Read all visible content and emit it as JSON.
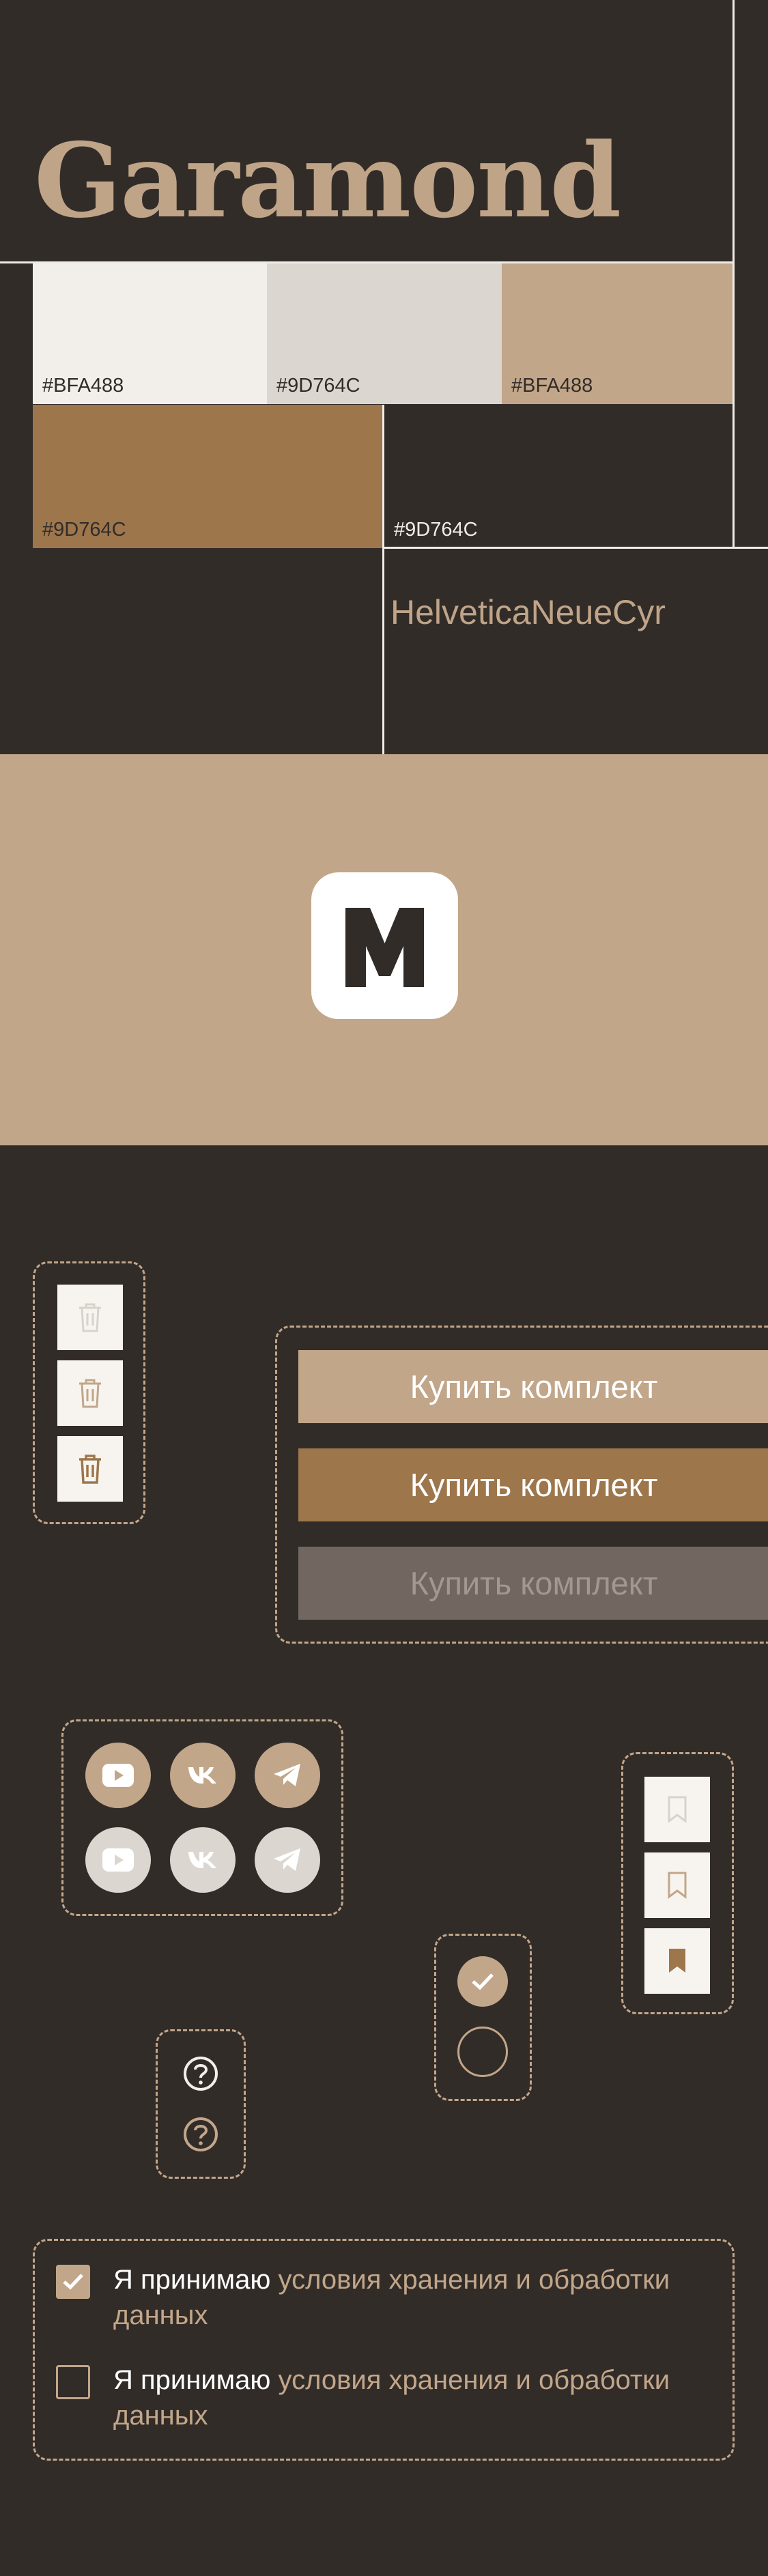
{
  "palette": {
    "title_serif": "Garamond",
    "title_sans": "HelveticaNeueCyr",
    "swatches": [
      {
        "hex": "#BFA488",
        "color": "#f2efea"
      },
      {
        "hex": "#9D764C",
        "color": "#dbd6d0"
      },
      {
        "hex": "#BFA488",
        "color": "#c2a689"
      },
      {
        "hex": "#9D764C",
        "color": "#9d764c"
      },
      {
        "hex": "#9D764C",
        "color": "#322c29"
      }
    ]
  },
  "brand": {
    "logo_letter": "M",
    "colors": {
      "dark": "#322c29",
      "beige": "#c2a689",
      "brown": "#9d764c",
      "light": "#f2efea",
      "gray": "#dbd6d0"
    }
  },
  "buttons": {
    "buy_default": "Купить комплект",
    "buy_hover": "Купить комплект",
    "buy_disabled": "Купить комплект"
  },
  "icons": {
    "trash": [
      "trash-icon-disabled",
      "trash-icon-default",
      "trash-icon-hover"
    ],
    "social": [
      "youtube-icon",
      "vk-icon",
      "telegram-icon"
    ],
    "bookmark": [
      "bookmark-icon-disabled",
      "bookmark-icon-default",
      "bookmark-icon-active"
    ],
    "help": "question-icon"
  },
  "consent": {
    "checked": {
      "prefix": "Я принимаю ",
      "link": "условия хранения и обработки данных",
      "state": "checked"
    },
    "unchecked": {
      "prefix": "Я принимаю ",
      "link": "условия хранения и обработки данных",
      "state": "unchecked"
    }
  }
}
